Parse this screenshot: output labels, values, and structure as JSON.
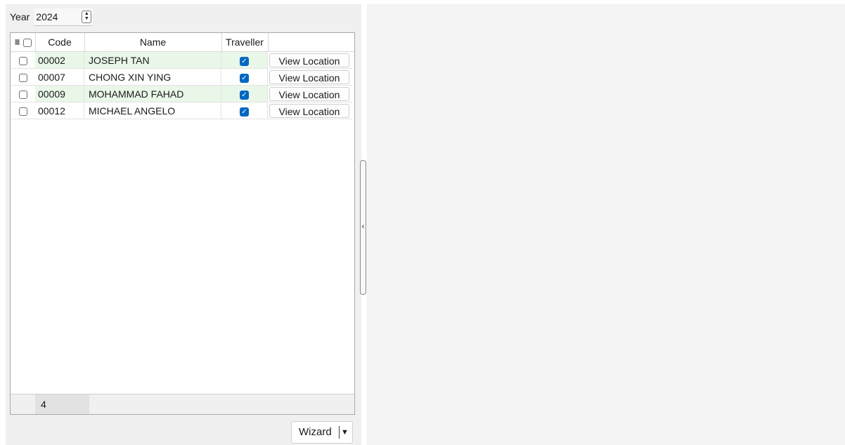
{
  "year": {
    "label": "Year",
    "value": "2024"
  },
  "grid": {
    "columns": {
      "code": "Code",
      "name": "Name",
      "traveller": "Traveller"
    },
    "rows": [
      {
        "code": "00002",
        "name": "JOSEPH TAN",
        "traveller": true,
        "action": "View Location"
      },
      {
        "code": "00007",
        "name": "CHONG XIN YING",
        "traveller": true,
        "action": "View Location"
      },
      {
        "code": "00009",
        "name": "MOHAMMAD FAHAD",
        "traveller": true,
        "action": "View Location"
      },
      {
        "code": "00012",
        "name": "MICHAEL ANGELO",
        "traveller": true,
        "action": "View Location"
      }
    ],
    "count": "4"
  },
  "wizard": {
    "label": "Wizard"
  },
  "colors": {
    "accent": "#0067c0",
    "row_highlight": "#e9f7e9"
  }
}
